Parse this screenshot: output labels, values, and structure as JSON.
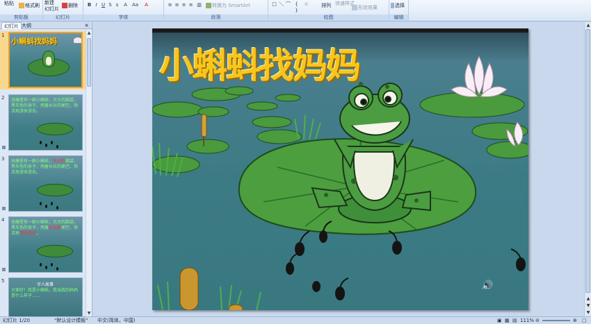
{
  "ribbon": {
    "paste_label": "粘贴",
    "format_painter_label": "格式刷",
    "new_slide_label": "新建\n幻灯片",
    "delete_label": "删除",
    "convert_smartart_label": "转换为 SmartArt",
    "arrange_label": "排列",
    "quick_styles_label": "快速样式",
    "shape_effects_label": "形状效果",
    "select_label": "选择",
    "groups": [
      "剪贴板",
      "幻灯片",
      "字体",
      "段落",
      "绘图",
      "编辑"
    ]
  },
  "panel": {
    "tabs": [
      "幻灯片",
      "大纲"
    ],
    "close_icon": "close-icon"
  },
  "thumbnails": [
    {
      "number": "1",
      "title": "小蝌蚪找妈妈"
    },
    {
      "number": "2",
      "text": "池塘里有一群小蝌蚪，大大的脑袋，黑灰色的身子，甩着长长的尾巴，快活地游来游去。"
    },
    {
      "number": "3",
      "text_a": "池塘里有一群小蝌蚪，",
      "text_red1": "大大的",
      "text_b": "脑袋，黑灰色的身子，甩着长长的尾巴，快活地游来游去。"
    },
    {
      "number": "4",
      "text_a": "池塘里有一群小蝌蚪，大大的脑袋，黑灰色的身子，甩着",
      "text_red1": "长长的",
      "text_b": "尾巴，快活地",
      "text_red2": "游来游去",
      "text_c": "。"
    },
    {
      "number": "5",
      "heading": "字人故事",
      "text": "大家好！我是小蝌蚪。我当我的妈妈是什么样子……"
    }
  ],
  "slide": {
    "title": "小蝌蚪找妈妈",
    "speaker_icon": "speaker-icon"
  },
  "status": {
    "slide_count": "幻灯片 1/20",
    "template": "\"默认设计模板\"",
    "language": "中文(简体，中国)",
    "zoom": "111%"
  },
  "colors": {
    "accent_selected": "#f0a030",
    "title_yellow": "#f8c51c",
    "pond": "#3f7e87"
  }
}
